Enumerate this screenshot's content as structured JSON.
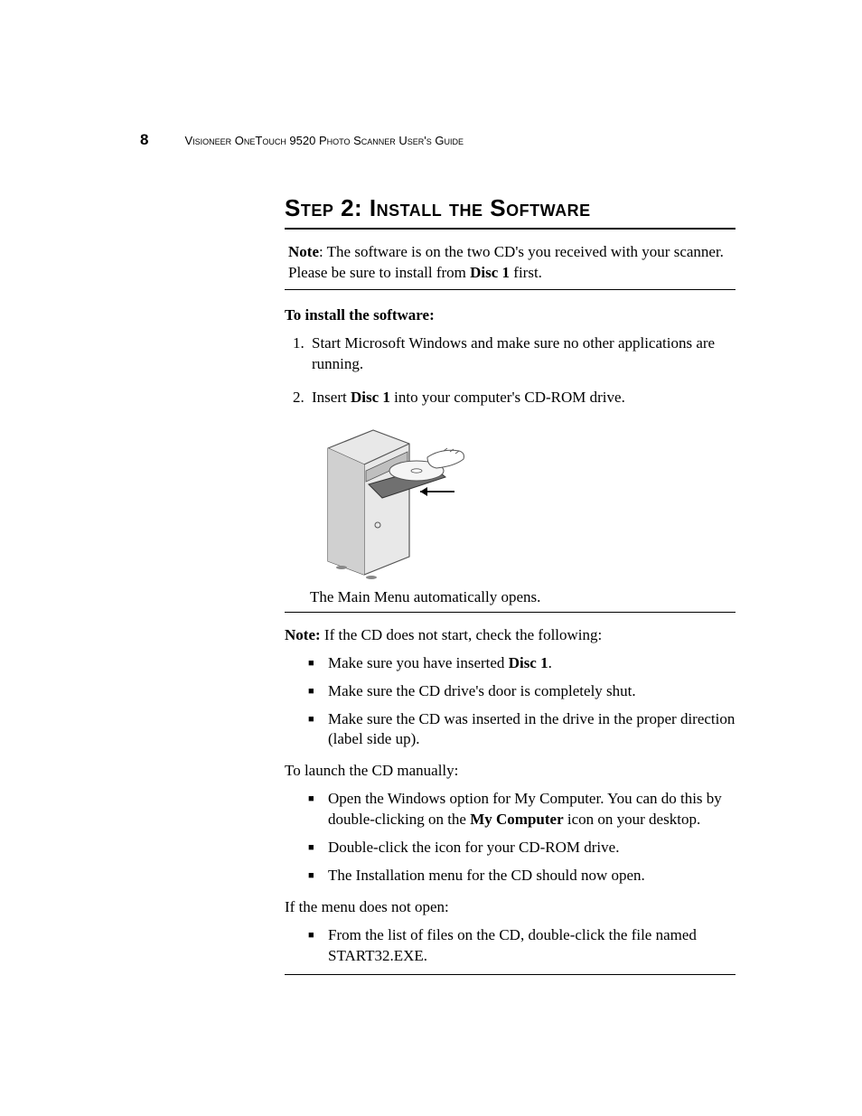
{
  "header": {
    "page_number": "8",
    "running_head": "Visioneer OneTouch 9520 Photo Scanner User's Guide"
  },
  "title": "Step 2: Install the Software",
  "note_box": {
    "label": "Note",
    "text_before": ":  The software is on the two CD's you received with your scanner. Please be sure to install from ",
    "bold": "Disc 1",
    "text_after": " first."
  },
  "subhead": "To install the software:",
  "steps": [
    {
      "text": "Start Microsoft Windows and make sure no other applications are running."
    },
    {
      "prefix": "Insert ",
      "bold": "Disc 1",
      "suffix": " into your computer's CD-ROM drive."
    }
  ],
  "after_illustration": "The Main Menu automatically opens.",
  "note2": {
    "label": "Note:",
    "text": " If the CD does not start, check the following:"
  },
  "check_bullets": [
    {
      "prefix": "Make sure you have inserted ",
      "bold": "Disc 1",
      "suffix": "."
    },
    {
      "text": "Make sure the CD drive's door is completely shut."
    },
    {
      "text": "Make sure the CD was inserted in the drive in the proper direction (label side up)."
    }
  ],
  "launch_heading": "To launch the CD manually:",
  "launch_bullets": [
    {
      "prefix": "Open the Windows option for My Computer. You can do this by double-clicking on the ",
      "bold": "My Computer",
      "suffix": " icon on your desktop."
    },
    {
      "text": "Double-click the icon for your CD-ROM drive."
    },
    {
      "text": "The Installation menu for the CD should now open."
    }
  ],
  "fallback_heading": "If the menu does not open:",
  "fallback_bullets": [
    {
      "text": "From the list of files on the CD, double-click the file named START32.EXE."
    }
  ]
}
